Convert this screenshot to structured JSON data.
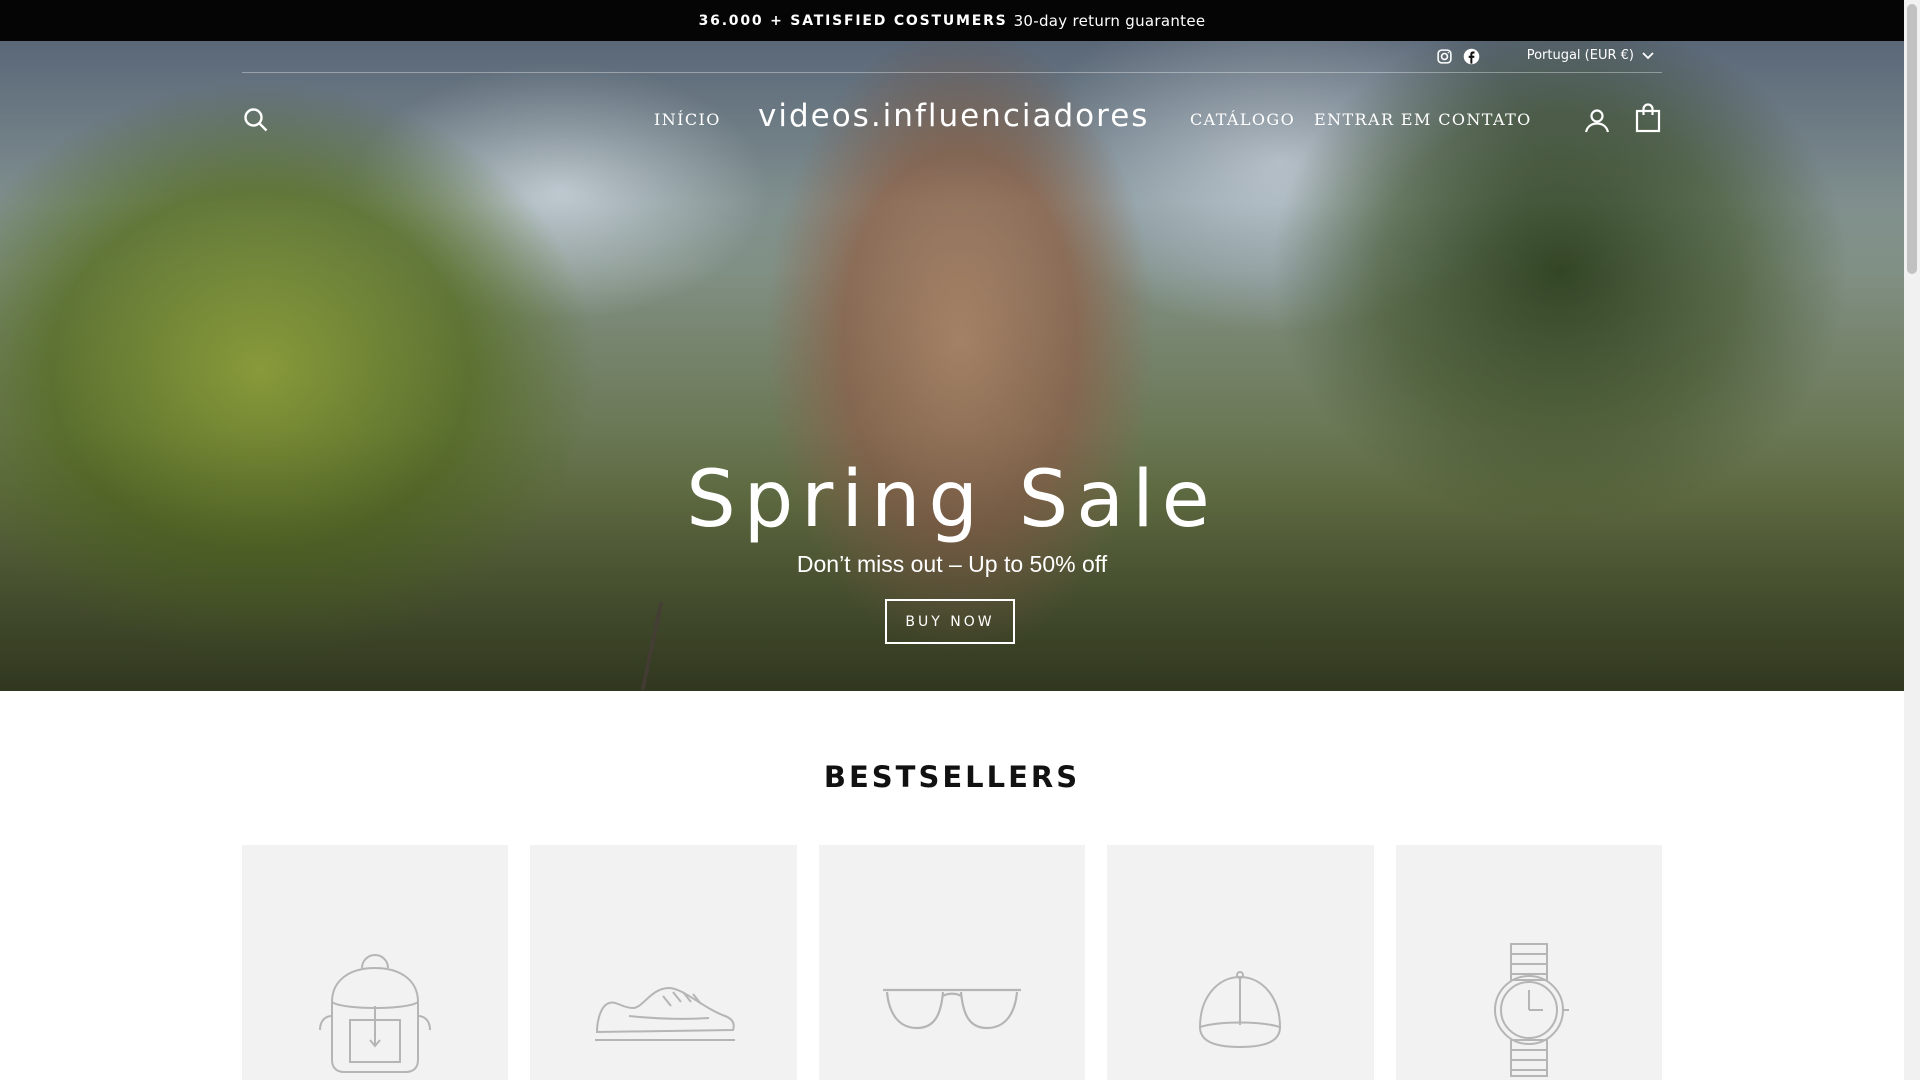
{
  "announcement": {
    "highlight": "36.000 + SATISFIED COSTUMERS",
    "text": "30-day return guarantee"
  },
  "utility": {
    "social": [
      "instagram-icon",
      "facebook-icon"
    ],
    "currency": "Portugal (EUR €)"
  },
  "nav": {
    "search_icon": "search-icon",
    "links_left": [
      "INÍCIO"
    ],
    "logo": "videos.influenciadores",
    "links_right": [
      "CATÁLOGO",
      "ENTRAR EM CONTATO"
    ],
    "account_icon": "user-icon",
    "cart_icon": "bag-icon"
  },
  "hero": {
    "title": "Spring Sale",
    "subtitle": "Don’t miss out – Up to 50% off",
    "button": "BUY NOW"
  },
  "bestsellers": {
    "title": "BESTSELLERS",
    "products": [
      {
        "icon": "backpack-icon"
      },
      {
        "icon": "sneaker-icon"
      },
      {
        "icon": "sunglasses-icon"
      },
      {
        "icon": "cap-icon"
      },
      {
        "icon": "watch-icon"
      }
    ]
  },
  "colors": {
    "announcement_bg": "#050505",
    "card_bg": "#f2f2f2",
    "text": "#111111"
  }
}
